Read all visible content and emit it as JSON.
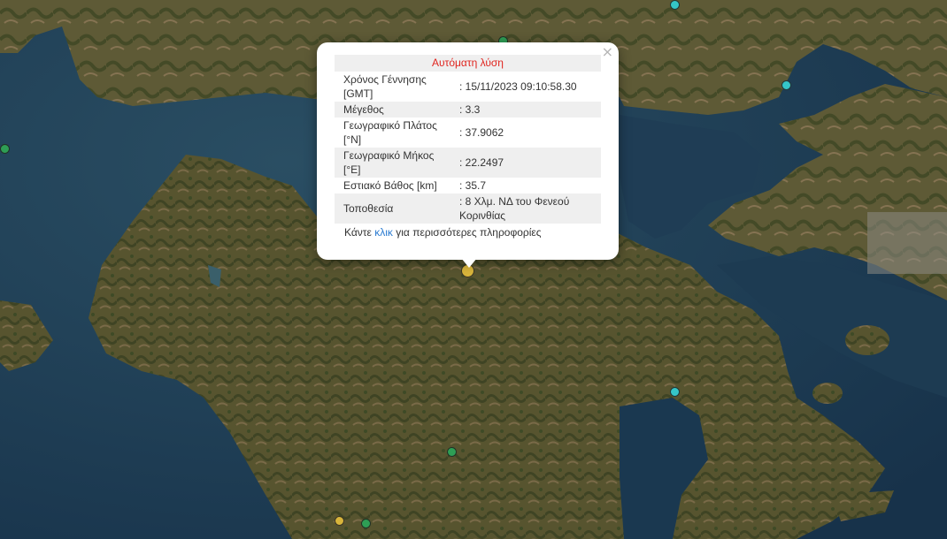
{
  "popup": {
    "title": "Αυτόματη λύση",
    "close_symbol": "×",
    "rows": [
      {
        "label": "Χρόνος Γέννησης [GMT]",
        "value": ": 15/11/2023 09:10:58.30"
      },
      {
        "label": "Μέγεθος",
        "value": ": 3.3"
      },
      {
        "label": "Γεωγραφικό Πλάτος [°N]",
        "value": ": 37.9062"
      },
      {
        "label": "Γεωγραφικό Μήκος [°E]",
        "value": ": 22.2497"
      },
      {
        "label": "Εστιακό Βάθος [km]",
        "value": ": 35.7"
      },
      {
        "label": "Τοποθεσία",
        "value": ": 8 Χλμ. ΝΔ του Φενεού Κορινθίας"
      }
    ],
    "more_prefix": "Κάντε",
    "more_link": "κλικ",
    "more_suffix": "για περισσότερες πληροφορίες"
  },
  "colors": {
    "marker_green": "#2e9e55",
    "marker_cyan": "#35c6c8",
    "marker_yellow": "#d9b53b",
    "title_red": "#e0251f",
    "link_blue": "#2b7bd1"
  },
  "icons": {
    "close": "close-icon",
    "marker": "earthquake-marker-icon"
  }
}
